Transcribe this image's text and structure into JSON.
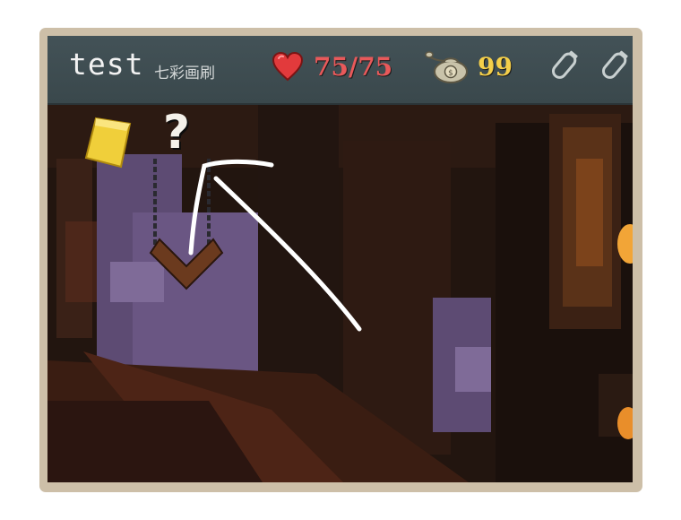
{
  "hud": {
    "player_name": "test",
    "player_title": "七彩画刷",
    "hp": "75/75",
    "gold": "99",
    "hp_icon": "heart-icon",
    "gold_icon": "money-bag-icon",
    "potion_icon": "empty-potion-slot-icon"
  },
  "scene": {
    "relic_icon": "yellow-relic-icon",
    "unknown_mark": "?",
    "annotation": "hand-drawn-arrow"
  },
  "colors": {
    "hp": "#e8595a",
    "gold": "#f4cf4a",
    "hud_bg": "#435257",
    "frame": "#cdbfa8"
  }
}
